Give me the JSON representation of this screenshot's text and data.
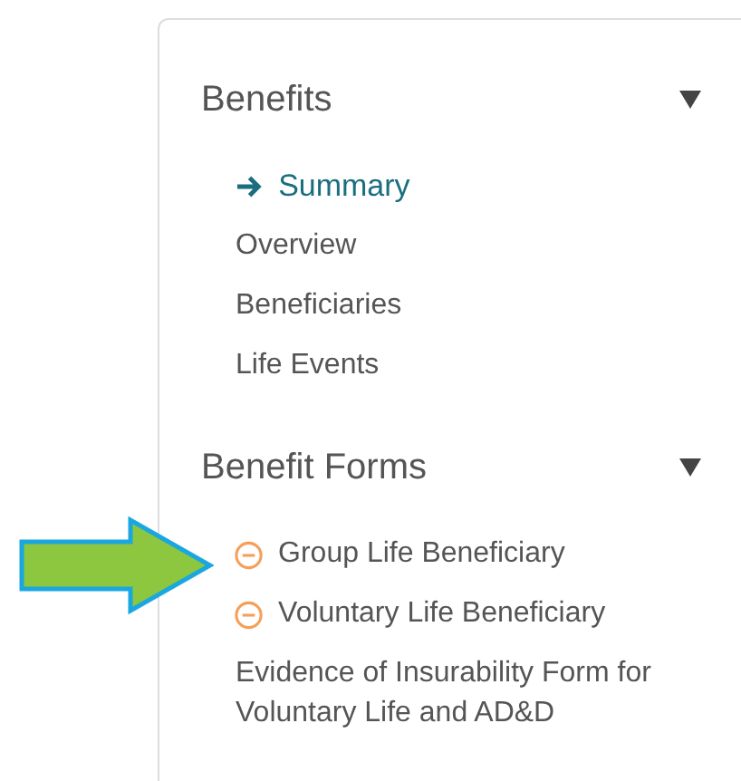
{
  "sections": [
    {
      "title": "Benefits",
      "expanded": true,
      "items": [
        {
          "label": "Summary",
          "kind": "link",
          "selected": true
        },
        {
          "label": "Overview",
          "kind": "link",
          "selected": false
        },
        {
          "label": "Beneficiaries",
          "kind": "link",
          "selected": false
        },
        {
          "label": "Life Events",
          "kind": "link",
          "selected": false
        }
      ]
    },
    {
      "title": "Benefit Forms",
      "expanded": true,
      "items": [
        {
          "label": "Group Life Beneficiary",
          "kind": "pending",
          "selected": false
        },
        {
          "label": "Voluntary Life Beneficiary",
          "kind": "pending",
          "selected": false
        },
        {
          "label": "Evidence of Insurability Form for Voluntary Life and AD&D",
          "kind": "link",
          "selected": false
        }
      ]
    }
  ]
}
